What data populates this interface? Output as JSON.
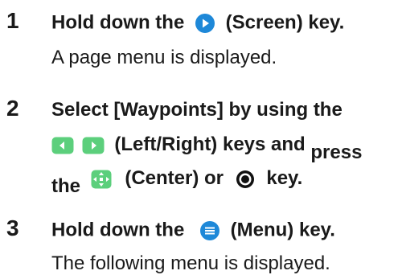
{
  "steps": [
    {
      "number": "1",
      "instruction": {
        "before": "Hold down the",
        "key": "(Screen) key."
      },
      "result": "A page menu is displayed."
    },
    {
      "number": "2",
      "instruction": {
        "line1": "Select [Waypoints] by using the",
        "keys_text": "(Left/Right) keys and",
        "press": "press",
        "the": "the",
        "center_text": "(Center) or",
        "key_end": "key."
      }
    },
    {
      "number": "3",
      "instruction": {
        "before": "Hold down the",
        "key": "(Menu) key."
      },
      "result": "The following menu is displayed."
    }
  ],
  "icons": {
    "screen_key": "screen-key-icon",
    "left_key": "left-arrow-key-icon",
    "right_key": "right-arrow-key-icon",
    "center_key": "center-key-icon",
    "enter_key": "enter-dot-key-icon",
    "menu_key": "menu-key-icon"
  },
  "colors": {
    "text": "#1a1a1a",
    "screen_key_blue": "#1e88d8",
    "arrow_key_green": "#5ccf7c",
    "center_key_green": "#5ccf7c",
    "menu_key_blue": "#1e88d8",
    "enter_key_black": "#111111"
  }
}
